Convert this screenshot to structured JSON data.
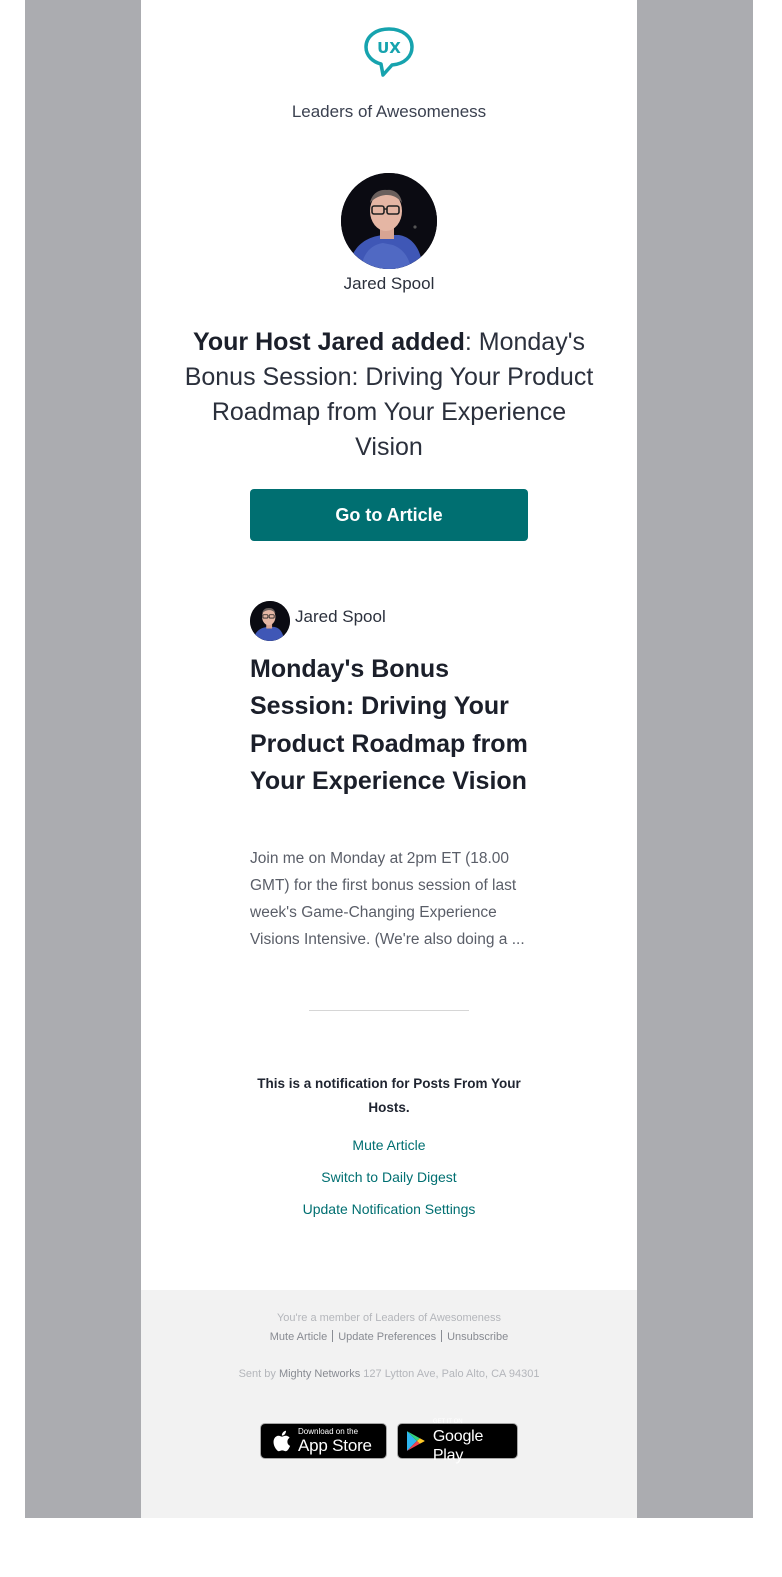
{
  "brand": {
    "logo_text": "UX",
    "community_name": "Leaders of Awesomeness",
    "accent_color": "#006f71",
    "logo_color": "#16a3ae"
  },
  "host": {
    "name": "Jared Spool"
  },
  "headline": {
    "bold": "Your Host Jared added",
    "rest": ": Monday's Bonus Session: Driving Your Product Roadmap from Your Experience Vision"
  },
  "cta": {
    "label": "Go to Article"
  },
  "post": {
    "author": "Jared Spool",
    "title": "Monday's Bonus Session: Driving Your Product Roadmap from Your Experience Vision",
    "excerpt": "Join me on Monday at 2pm ET (18.00 GMT) for the first bonus session of last week's Game-Changing Experience Visions Intensive. (We're also doing a ..."
  },
  "notification": {
    "notice": "This is a notification for Posts From Your Hosts.",
    "links": {
      "mute": "Mute Article",
      "digest": "Switch to Daily Digest",
      "settings": "Update Notification Settings"
    }
  },
  "footer": {
    "member_text": "You're a member of Leaders of Awesomeness",
    "links": {
      "mute": "Mute Article",
      "preferences": "Update Preferences",
      "unsubscribe": "Unsubscribe"
    },
    "sent_by_prefix": "Sent by",
    "sender": "Mighty Networks",
    "address": "127 Lytton Ave, Palo Alto, CA 94301"
  },
  "badges": {
    "apple": {
      "small": "Download on the",
      "big": "App Store",
      "icon": "apple-icon"
    },
    "google": {
      "small": "GET IT ON",
      "big": "Google Play",
      "icon": "google-play-icon"
    }
  }
}
